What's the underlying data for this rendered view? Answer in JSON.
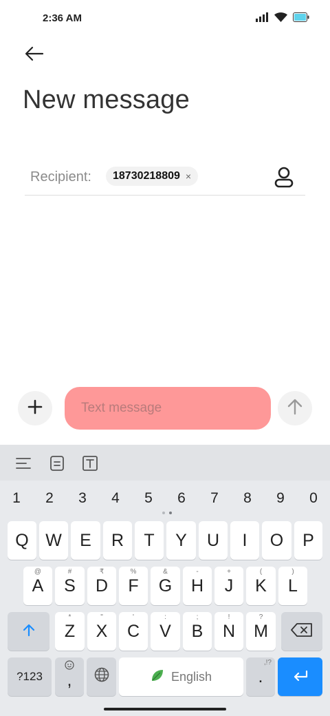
{
  "status_bar": {
    "time": "2:36 AM"
  },
  "header": {
    "title": "New message"
  },
  "recipient": {
    "label": "Recipient:",
    "chip_number": "18730218809",
    "chip_remove": "×"
  },
  "compose": {
    "placeholder": "Text message",
    "field_color": "#fe9898"
  },
  "keyboard": {
    "numbers": [
      "1",
      "2",
      "3",
      "4",
      "5",
      "6",
      "7",
      "8",
      "9",
      "0"
    ],
    "row1": [
      "Q",
      "W",
      "E",
      "R",
      "T",
      "Y",
      "U",
      "I",
      "O",
      "P"
    ],
    "row2": [
      "A",
      "S",
      "D",
      "F",
      "G",
      "H",
      "J",
      "K",
      "L"
    ],
    "row2_hints": [
      "@",
      "#",
      "₹",
      "%",
      "&",
      "-",
      "+",
      "(",
      ")"
    ],
    "row3": [
      "Z",
      "X",
      "C",
      "V",
      "B",
      "N",
      "M"
    ],
    "row3_hints": [
      "*",
      "\"",
      "'",
      ":",
      ";",
      "!",
      "?"
    ],
    "sym_label": "?123",
    "comma_label": ",",
    "space_label": "English",
    "period_label": ".",
    "period_hint": ",!?",
    "accent_color": "#1a8dff"
  }
}
